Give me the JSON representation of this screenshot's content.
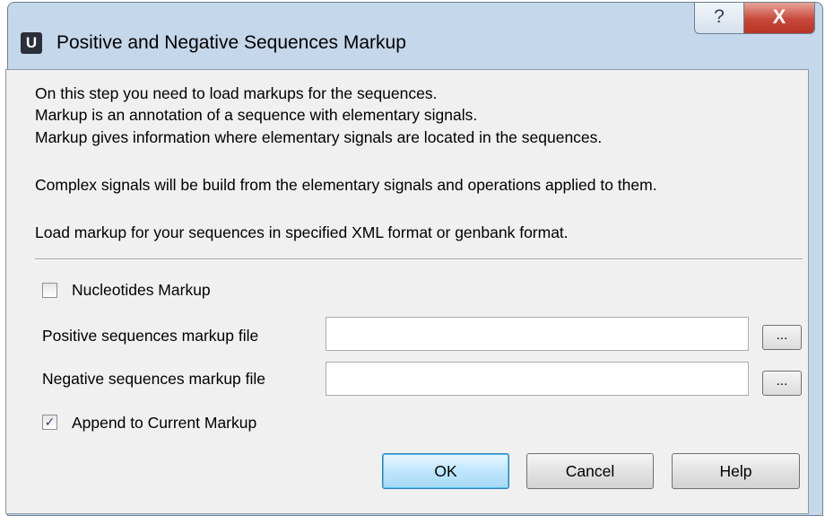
{
  "window": {
    "title": "Positive and Negative Sequences Markup",
    "app_icon_letter": "U",
    "help_glyph": "?",
    "close_glyph": "X"
  },
  "description": {
    "line1": "On this step you need to load markups for the sequences.",
    "line2": "Markup is an annotation of a sequence with elementary signals.",
    "line3": "Markup gives information where elementary signals are located in the sequences.",
    "line4": "Complex signals will be build from the elementary signals and operations applied to them.",
    "line5": "Load markup for your sequences in specified XML format or genbank format."
  },
  "nucleotides_checkbox": {
    "label": "Nucleotides Markup",
    "checked": false
  },
  "positive_field": {
    "label": "Positive sequences markup file",
    "value": "",
    "browse_label": "..."
  },
  "negative_field": {
    "label": "Negative sequences markup file",
    "value": "",
    "browse_label": "..."
  },
  "append_checkbox": {
    "label": "Append to Current Markup",
    "checked": true,
    "check_glyph": "✓"
  },
  "buttons": {
    "ok": "OK",
    "cancel": "Cancel",
    "help": "Help"
  }
}
